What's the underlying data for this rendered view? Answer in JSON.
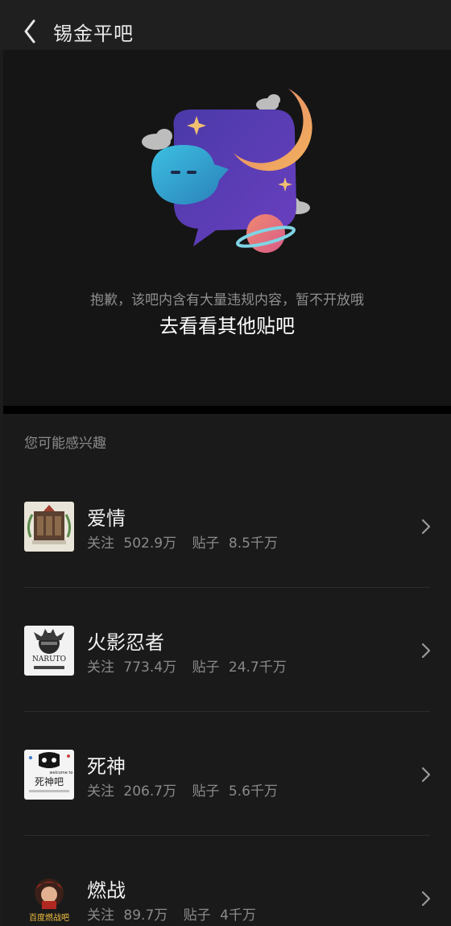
{
  "header": {
    "title": "锡金平吧"
  },
  "notice": {
    "message": "抱歉，该吧内含有大量违规内容，暂不开放哦",
    "link": "去看看其他贴吧"
  },
  "suggestions": {
    "heading": "您可能感兴趣",
    "follow_label": "关注",
    "posts_label": "贴子",
    "items": [
      {
        "name": "爱情",
        "follows": "502.9万",
        "posts": "8.5千万"
      },
      {
        "name": "火影忍者",
        "follows": "773.4万",
        "posts": "24.7千万"
      },
      {
        "name": "死神",
        "follows": "206.7万",
        "posts": "5.6千万"
      },
      {
        "name": "燃战",
        "follows": "89.7万",
        "posts": "4千万"
      }
    ],
    "avatar_text": {
      "naruto": "NARUTO",
      "bleach_top": "welcome to",
      "bleach_main": "死神吧",
      "ranzhan": "百度燃战吧"
    }
  },
  "colors": {
    "background": "#1c1c1c",
    "panel": "#151515",
    "moon": "#f0a85a",
    "bubble": "#5b3fbf",
    "ghost": "#2fa8d6",
    "planet": "#e8727f"
  }
}
